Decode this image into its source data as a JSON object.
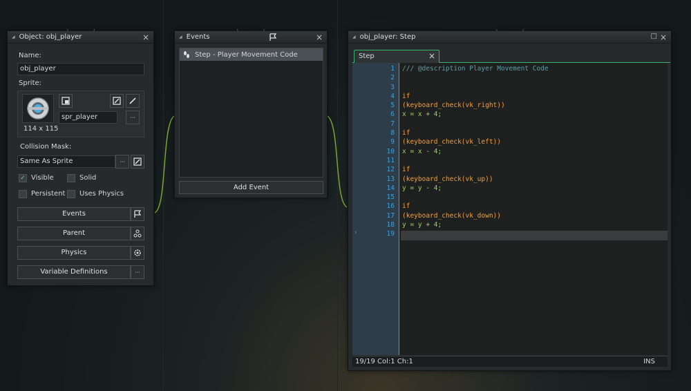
{
  "object_panel": {
    "title": "Object: obj_player",
    "name_label": "Name:",
    "name_value": "obj_player",
    "sprite_label": "Sprite:",
    "sprite_name": "spr_player",
    "sprite_size": "114 x 115",
    "collision_label": "Collision Mask:",
    "collision_value": "Same As Sprite",
    "visible_label": "Visible",
    "solid_label": "Solid",
    "persistent_label": "Persistent",
    "uses_physics_label": "Uses Physics",
    "events_btn": "Events",
    "parent_btn": "Parent",
    "physics_btn": "Physics",
    "variable_btn": "Variable Definitions",
    "dots": "···",
    "visible_checked": true,
    "solid_checked": false,
    "persistent_checked": false,
    "uses_physics_checked": false
  },
  "events_panel": {
    "title": "Events",
    "items": [
      {
        "label": "Step - Player Movement Code"
      }
    ],
    "add_event": "Add Event"
  },
  "code_panel": {
    "title": "obj_player: Step",
    "tab_label": "Step",
    "status_left": "19/19 Col:1 Ch:1",
    "status_right": "INS",
    "lines": [
      "1",
      "2",
      "3",
      "4",
      "5",
      "6",
      "7",
      "8",
      "9",
      "10",
      "11",
      "12",
      "13",
      "14",
      "15",
      "16",
      "17",
      "18",
      "19"
    ],
    "code": {
      "l1": "/// @description Player Movement Code",
      "if": "if",
      "l5": "(keyboard_check(vk_right))",
      "l6": "x = x + 4;",
      "l9": "(keyboard_check(vk_left))",
      "l10": "x = x - 4;",
      "l13": "(keyboard_check(vk_up))",
      "l14": "y = y - 4;",
      "l17": "(keyboard_check(vk_down))",
      "l18": "y = y + 4;"
    }
  },
  "colors": {
    "accent": "#3aa3e0",
    "tab_accent": "#39b36b",
    "wire": "#7fa530"
  }
}
